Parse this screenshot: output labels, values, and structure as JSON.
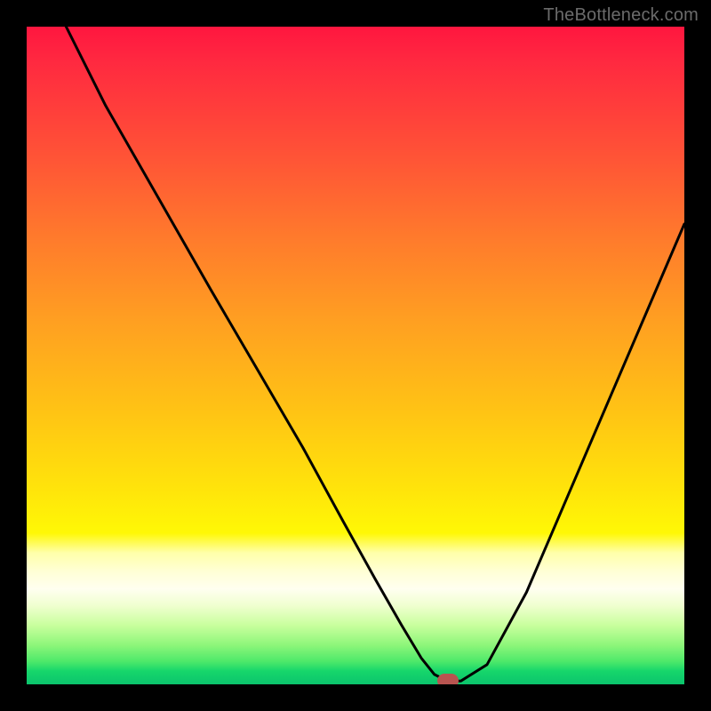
{
  "watermark": "TheBottleneck.com",
  "chart_data": {
    "type": "line",
    "title": "",
    "xlabel": "",
    "ylabel": "",
    "xlim": [
      0,
      100
    ],
    "ylim": [
      0,
      100
    ],
    "grid": false,
    "legend": false,
    "series": [
      {
        "name": "bottleneck-curve",
        "x": [
          6,
          12,
          20,
          28,
          35,
          42,
          48,
          53,
          57,
          60,
          62,
          64,
          66,
          70,
          76,
          82,
          88,
          94,
          100
        ],
        "y": [
          100,
          88,
          74,
          60,
          48,
          36,
          25,
          16,
          9,
          4,
          1.5,
          0.5,
          0.5,
          3,
          14,
          28,
          42,
          56,
          70
        ],
        "color": "#000000"
      }
    ],
    "marker": {
      "x": 64,
      "y": 0.5,
      "color": "#b85450"
    },
    "background_gradient": {
      "orientation": "vertical",
      "stops": [
        {
          "pos": 0,
          "color": "#ff163f"
        },
        {
          "pos": 0.45,
          "color": "#ffa021"
        },
        {
          "pos": 0.77,
          "color": "#fff805"
        },
        {
          "pos": 0.86,
          "color": "#fffff0"
        },
        {
          "pos": 1.0,
          "color": "#0bc46c"
        }
      ]
    }
  }
}
